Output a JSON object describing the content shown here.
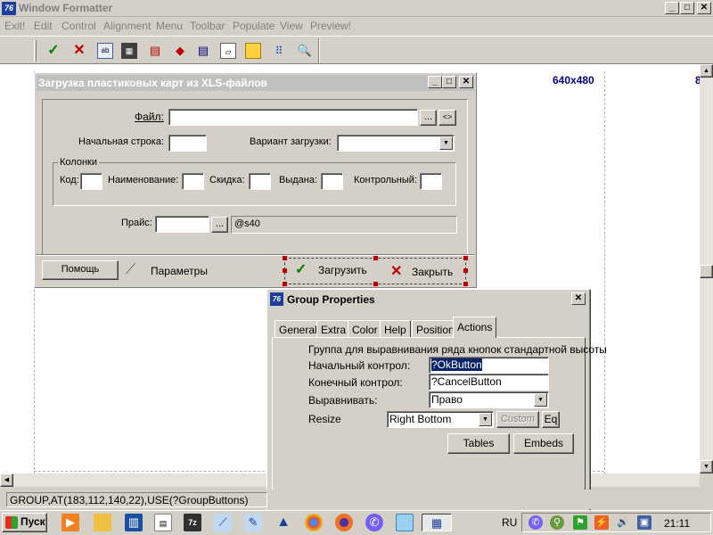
{
  "app": {
    "title": "Window Formatter",
    "logo": "76"
  },
  "menu": [
    "Exit!",
    "Edit",
    "Control",
    "Alignment",
    "Menu",
    "Toolbar",
    "Populate",
    "View",
    "Preview!"
  ],
  "toolbar_icons": [
    "check-icon",
    "cross-icon",
    "prompt-icon",
    "string-icon",
    "entry-icon",
    "button-icon",
    "list-icon",
    "image-icon",
    "panel-icon",
    "grid-icon",
    "zoom-icon"
  ],
  "canvas": {
    "size_label_1": "640x480",
    "size_label_2": "8"
  },
  "dialog": {
    "title": "Загрузка пластиковых карт из XLS-файлов",
    "file_label": "Файл:",
    "file_value": "",
    "browse_label": "...",
    "toggle_label": "<>",
    "start_row_label": "Начальная строка:",
    "load_variant_label": "Вариант загрузки:",
    "columns_group": "Колонки",
    "col_code": "Код:",
    "col_name": "Наименование:",
    "col_discount": "Скидка:",
    "col_issued": "Выдана:",
    "col_control": "Контрольный:",
    "price_label": "Прайс:",
    "price_browse": "...",
    "price_display": "@s40",
    "help_button": "Помощь",
    "params_button": "Параметры",
    "load_button": "Загрузить",
    "close_button": "Закрыть"
  },
  "group_props": {
    "title": "Group Properties",
    "logo": "76",
    "tabs": [
      "General",
      "Extra",
      "Color",
      "Help",
      "Position",
      "Actions"
    ],
    "active_tab": "Actions",
    "description": "Группа для выравнивания ряда кнопок стандартной высоты",
    "start_label": "Начальный контрол:",
    "start_value": "?OkButton",
    "end_label": "Конечный контрол:",
    "end_value": "?CancelButton",
    "align_label": "Выравнивать:",
    "align_value": "Право",
    "resize_label": "Resize",
    "resize_value": "Right Bottom",
    "custom_button": "Custom",
    "eq_button": "Eq",
    "tables_button": "Tables",
    "embeds_button": "Embeds"
  },
  "status_bar": {
    "text": "GROUP,AT(183,112,140,22),USE(?GroupButtons)"
  },
  "taskbar": {
    "start_label": "Пуск",
    "lang": "RU",
    "time": "21:11"
  }
}
